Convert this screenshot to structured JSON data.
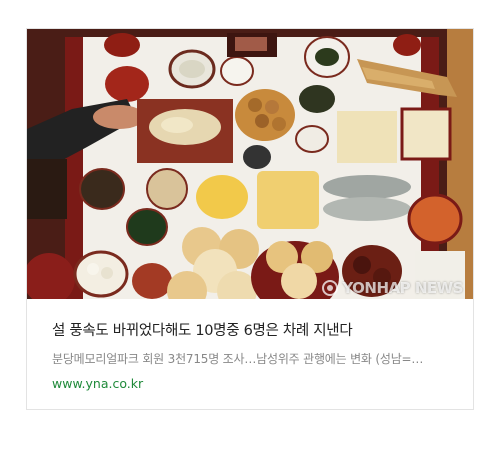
{
  "article": {
    "headline": "설 풍속도 바뀌었다해도 10명중 6명은 차례 지낸다",
    "snippet": "분당메모리얼파크 회원 3천715명 조사…남성위주 관행에는 변화 (성남=…",
    "source": "www.yna.co.kr",
    "image_watermark": "YONHAP NEWS",
    "image_icon": "yonhap-logo-icon"
  },
  "colors": {
    "headline": "#222222",
    "snippet": "#888888",
    "source": "#1f8a3a",
    "border": "#e3e3e3"
  }
}
